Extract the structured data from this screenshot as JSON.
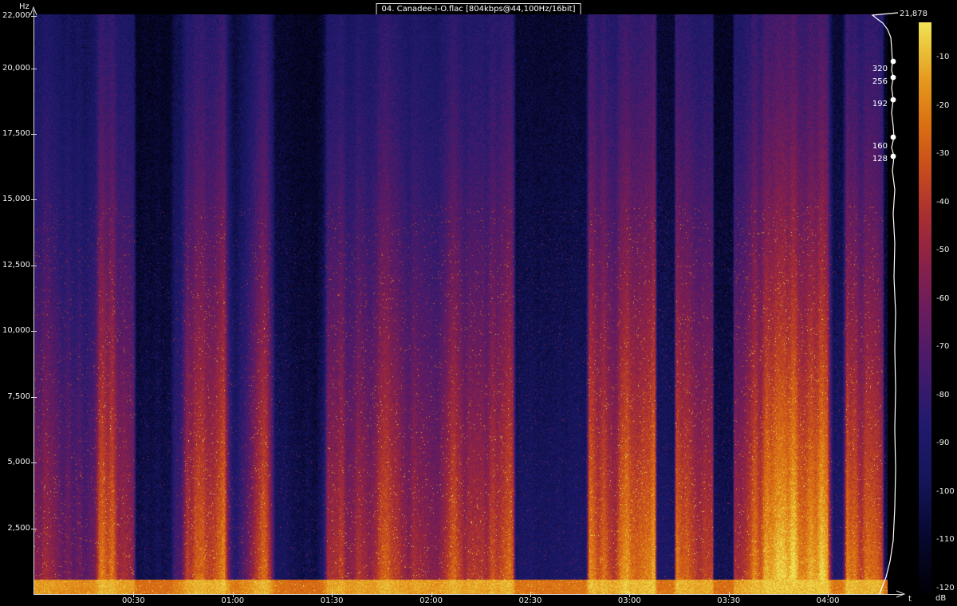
{
  "chart_data": {
    "type": "heatmap",
    "subtype": "audio-spectrogram",
    "title": "04. Canadee-I-O.flac [804kbps@44,100Hz/16bit]",
    "xlabel": "t",
    "ylabel": "Hz",
    "x_range_seconds": [
      0,
      260
    ],
    "y_range_hz": [
      0,
      22050
    ],
    "x_ticks": [
      {
        "label": "00:30",
        "sec": 30
      },
      {
        "label": "01:00",
        "sec": 60
      },
      {
        "label": "01:30",
        "sec": 90
      },
      {
        "label": "02:00",
        "sec": 120
      },
      {
        "label": "02:30",
        "sec": 150
      },
      {
        "label": "03:00",
        "sec": 180
      },
      {
        "label": "03:30",
        "sec": 210
      },
      {
        "label": "04:00",
        "sec": 240
      }
    ],
    "y_ticks": [
      {
        "label": "22,000",
        "hz": 22000
      },
      {
        "label": "20,000",
        "hz": 20000
      },
      {
        "label": "17,500",
        "hz": 17500
      },
      {
        "label": "15,000",
        "hz": 15000
      },
      {
        "label": "12,500",
        "hz": 12500
      },
      {
        "label": "10,000",
        "hz": 10000
      },
      {
        "label": "7,500",
        "hz": 7500
      },
      {
        "label": "5,000",
        "hz": 5000
      },
      {
        "label": "2,500",
        "hz": 2500
      }
    ],
    "color_scale": {
      "unit": "dB",
      "min_db": -120,
      "max_db": 0,
      "tick_labels": [
        "-10",
        "-20",
        "-30",
        "-40",
        "-50",
        "-60",
        "-70",
        "-80",
        "-90",
        "-100",
        "-110",
        "-120"
      ],
      "palette_stops": [
        [
          0.0,
          "#000006"
        ],
        [
          0.1,
          "#07072e"
        ],
        [
          0.2,
          "#15155a"
        ],
        [
          0.3,
          "#221a6e"
        ],
        [
          0.4,
          "#471a6b"
        ],
        [
          0.5,
          "#6b1c5c"
        ],
        [
          0.58,
          "#8a2148"
        ],
        [
          0.66,
          "#a82e32"
        ],
        [
          0.74,
          "#c64b1e"
        ],
        [
          0.82,
          "#da6f12"
        ],
        [
          0.9,
          "#e59a1e"
        ],
        [
          0.96,
          "#ecc63c"
        ],
        [
          1.0,
          "#f0e455"
        ]
      ]
    },
    "cutoff_curve": {
      "max_frequency_label": "21,878",
      "max_frequency_hz": 21878,
      "color": "#ffffff",
      "bitrate_markers": [
        {
          "label": "320",
          "hz": 20260,
          "label_dy": 10
        },
        {
          "label": "256",
          "hz": 19650,
          "label_dy": 6
        },
        {
          "label": "192",
          "hz": 18800,
          "label_dy": 6
        },
        {
          "label": "160",
          "hz": 17380,
          "label_dy": 12
        },
        {
          "label": "128",
          "hz": 16650,
          "label_dy": 4
        }
      ],
      "curve_points": [
        [
          1126,
          16
        ],
        [
          1094,
          19
        ],
        [
          1099,
          23
        ],
        [
          1107,
          29
        ],
        [
          1113,
          37
        ],
        [
          1117,
          47
        ],
        [
          1118,
          60
        ],
        [
          1119,
          77
        ],
        [
          1118,
          88
        ],
        [
          1120,
          97
        ],
        [
          1118,
          110
        ],
        [
          1120,
          125
        ],
        [
          1118,
          141
        ],
        [
          1120,
          158
        ],
        [
          1121,
          172
        ],
        [
          1118,
          185
        ],
        [
          1121,
          196
        ],
        [
          1119,
          214
        ],
        [
          1122,
          238
        ],
        [
          1120,
          268
        ],
        [
          1122,
          305
        ],
        [
          1121,
          348
        ],
        [
          1123,
          392
        ],
        [
          1122,
          438
        ],
        [
          1123,
          488
        ],
        [
          1122,
          538
        ],
        [
          1123,
          588
        ],
        [
          1122,
          636
        ],
        [
          1120,
          678
        ],
        [
          1116,
          704
        ],
        [
          1111,
          724
        ],
        [
          1105,
          739
        ],
        [
          1103,
          745
        ]
      ]
    },
    "render_seed": 20
  }
}
